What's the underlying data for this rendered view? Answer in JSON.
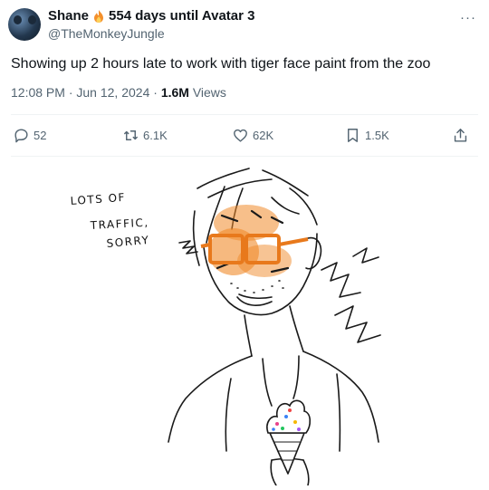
{
  "author": {
    "name": "Shane",
    "status": "554 days until Avatar 3",
    "handle": "@TheMonkeyJungle"
  },
  "tweet": {
    "text": "Showing up 2 hours late to work with tiger face paint from the zoo",
    "time": "12:08 PM",
    "date": "Jun 12, 2024",
    "views_count": "1.6M",
    "views_label": "Views"
  },
  "actions": {
    "replies": "52",
    "reposts": "6.1K",
    "likes": "62K",
    "bookmarks": "1.5K"
  },
  "image": {
    "caption_lines": [
      "LOTS OF",
      "TRAFFIC,",
      "SORRY"
    ]
  },
  "colors": {
    "text": "#0f1419",
    "secondary": "#536471",
    "face_paint": "#f08a2a"
  },
  "icons": [
    "more-icon",
    "reply-icon",
    "repost-icon",
    "like-icon",
    "bookmark-icon",
    "share-icon",
    "flame-emoji-icon"
  ]
}
